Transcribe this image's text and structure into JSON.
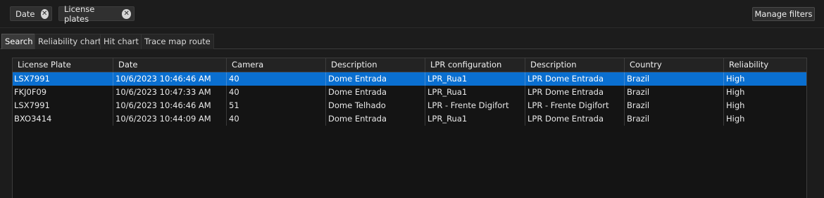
{
  "filters": [
    {
      "label": "Date"
    },
    {
      "label": "License plates"
    }
  ],
  "manage_filters_label": "Manage filters",
  "tabs": [
    {
      "label": "Search",
      "active": true
    },
    {
      "label": "Reliability chart",
      "active": false
    },
    {
      "label": "Hit chart",
      "active": false
    },
    {
      "label": "Trace map route",
      "active": false
    }
  ],
  "table": {
    "columns": [
      "License Plate",
      "Date",
      "Camera",
      "Description",
      "LPR configuration",
      "Description",
      "Country",
      "Reliability"
    ],
    "rows": [
      {
        "selected": true,
        "cells": [
          "LSX7991",
          "10/6/2023 10:46:46 AM",
          "40",
          "Dome Entrada",
          "LPR_Rua1",
          "LPR Dome Entrada",
          "Brazil",
          "High"
        ]
      },
      {
        "selected": false,
        "cells": [
          "FKJ0F09",
          "10/6/2023 10:47:33 AM",
          "40",
          "Dome Entrada",
          "LPR_Rua1",
          "LPR Dome Entrada",
          "Brazil",
          "High"
        ]
      },
      {
        "selected": false,
        "cells": [
          "LSX7991",
          "10/6/2023 10:46:46 AM",
          "51",
          "Dome Telhado",
          "LPR - Frente Digifort",
          "LPR - Frente Digifort",
          "Brazil",
          "High"
        ]
      },
      {
        "selected": false,
        "cells": [
          "BXO3414",
          "10/6/2023 10:44:09 AM",
          "40",
          "Dome Entrada",
          "LPR_Rua1",
          "LPR Dome Entrada",
          "Brazil",
          "High"
        ]
      }
    ]
  },
  "colors": {
    "background": "#1c1c1c",
    "selection": "#0a6fd0",
    "grid_background": "#141414"
  },
  "icons": {
    "chip_remove": "close-circle-icon"
  }
}
